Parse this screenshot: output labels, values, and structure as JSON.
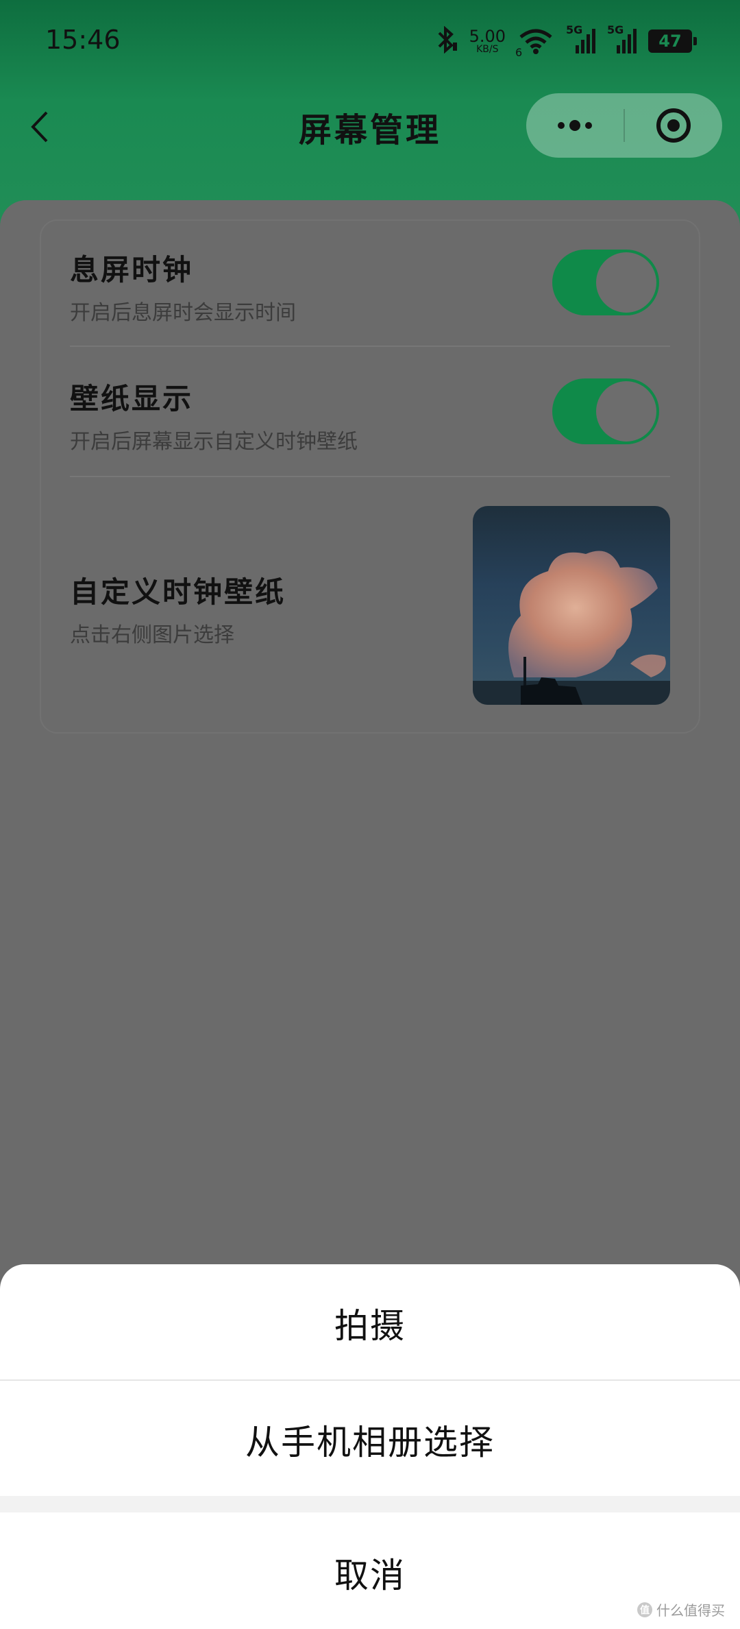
{
  "status_bar": {
    "time": "15:46",
    "net_speed_value": "5.00",
    "net_speed_unit": "KB/S",
    "wifi_badge": "6",
    "sim1_label": "5G",
    "sim2_label": "5G",
    "battery": "47"
  },
  "header": {
    "title": "屏幕管理",
    "background_color": "#0e6e3f"
  },
  "settings": {
    "items": [
      {
        "title": "息屏时钟",
        "subtitle": "开启后息屏时会显示时间",
        "toggle": true
      },
      {
        "title": "壁纸显示",
        "subtitle": "开启后屏幕显示自定义时钟壁纸",
        "toggle": true
      },
      {
        "title": "自定义时钟壁纸",
        "subtitle": "点击右侧图片选择"
      }
    ],
    "accent_color": "#0f8a49"
  },
  "action_sheet": {
    "options": [
      "拍摄",
      "从手机相册选择"
    ],
    "cancel": "取消"
  },
  "watermark": {
    "badge": "值",
    "text": "什么值得买"
  }
}
